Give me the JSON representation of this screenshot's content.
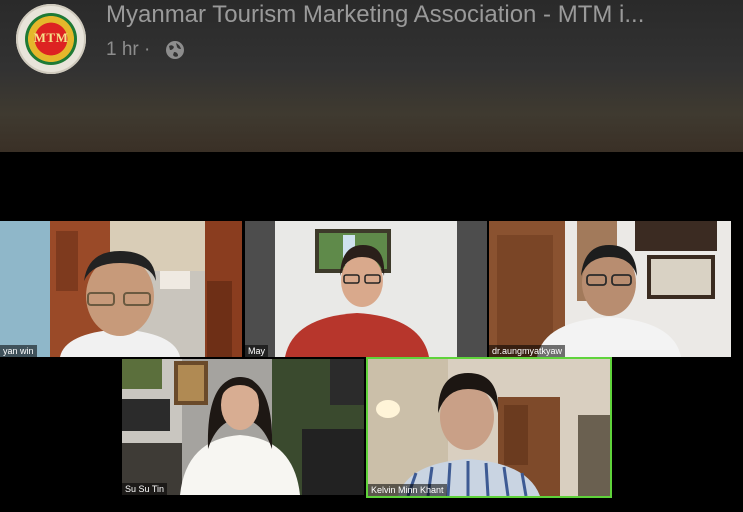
{
  "post": {
    "page_name": "Myanmar Tourism Marketing Association - MTM i...",
    "logo_text": "MTM",
    "time": "1 hr",
    "separator": "·",
    "privacy_icon": "globe-icon"
  },
  "meeting": {
    "participants": [
      {
        "name": "yan win",
        "active_speaker": false
      },
      {
        "name": "May",
        "active_speaker": false
      },
      {
        "name": "dr.aungmyatkyaw",
        "active_speaker": false
      },
      {
        "name": "Su Su Tin",
        "active_speaker": false
      },
      {
        "name": "Kelvin Minn Khant",
        "active_speaker": true
      }
    ],
    "active_speaker_color": "#5fd33b"
  }
}
